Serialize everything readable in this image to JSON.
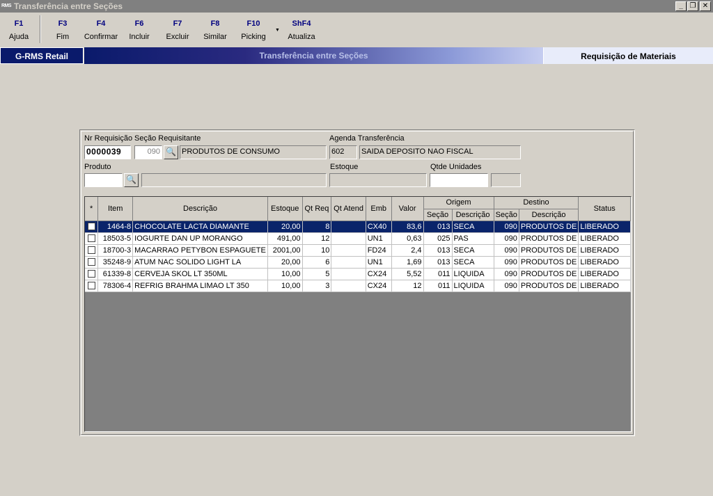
{
  "window": {
    "icon_text": "RMS",
    "title": "Transferência entre Seções",
    "controls": {
      "minimize": "_",
      "restore": "❐",
      "close": "✕"
    }
  },
  "toolbar": {
    "items": [
      {
        "key": "F1",
        "label": "Ajuda"
      },
      {
        "key": "F3",
        "label": "Fim"
      },
      {
        "key": "F4",
        "label": "Confirmar"
      },
      {
        "key": "F6",
        "label": "Incluir"
      },
      {
        "key": "F7",
        "label": "Excluir"
      },
      {
        "key": "F8",
        "label": "Similar"
      },
      {
        "key": "F10",
        "label": "Picking"
      },
      {
        "key": "ShF4",
        "label": "Atualiza"
      }
    ],
    "dropdown_arrow": "▼"
  },
  "banner": {
    "left": "G-RMS Retail",
    "middle": "Transferência entre Seções",
    "right": "Requisição de Materiais"
  },
  "form": {
    "nr_requisicao_label": "Nr Requisição",
    "nr_requisicao_value": "0000039",
    "secao_requisitante_label": "Seção Requisitante",
    "secao_code": "090",
    "secao_desc": "PRODUTOS DE CONSUMO",
    "agenda_label": "Agenda Transferência",
    "agenda_code": "602",
    "agenda_desc": "SAIDA DEPOSITO NAO FISCAL",
    "produto_label": "Produto",
    "produto_value": "",
    "produto_desc": "",
    "estoque_label": "Estoque",
    "estoque_value": "",
    "qtde_label": "Qtde Unidades",
    "qtde_value": "",
    "qtde_extra": "",
    "search_icon": "binoculars-icon"
  },
  "grid": {
    "headers": {
      "star": "*",
      "item": "Item",
      "descricao": "Descrição",
      "estoque": "Estoque",
      "qt_req": "Qt Req",
      "qt_atend": "Qt Atend",
      "emb": "Emb",
      "valor": "Valor",
      "origem": "Origem",
      "destino": "Destino",
      "secao": "Seção",
      "desc_sub": "Descrição",
      "status": "Status"
    },
    "rows": [
      {
        "item": "1464-8",
        "descricao": "CHOCOLATE LACTA DIAMANTE",
        "estoque": "20,00",
        "qt_req": "8",
        "qt_atend": "",
        "emb": "CX40",
        "valor": "83,6",
        "orig_secao": "013",
        "orig_desc": "SECA",
        "dest_secao": "090",
        "dest_desc": "PRODUTOS DE",
        "status": "LIBERADO",
        "selected": true
      },
      {
        "item": "18503-5",
        "descricao": "IOGURTE DAN UP MORANGO",
        "estoque": "491,00",
        "qt_req": "12",
        "qt_atend": "",
        "emb": "UN1",
        "valor": "0,63",
        "orig_secao": "025",
        "orig_desc": "PAS",
        "dest_secao": "090",
        "dest_desc": "PRODUTOS DE",
        "status": "LIBERADO",
        "selected": false
      },
      {
        "item": "18700-3",
        "descricao": "MACARRAO PETYBON ESPAGUETE",
        "estoque": "2001,00",
        "qt_req": "10",
        "qt_atend": "",
        "emb": "FD24",
        "valor": "2,4",
        "orig_secao": "013",
        "orig_desc": "SECA",
        "dest_secao": "090",
        "dest_desc": "PRODUTOS DE",
        "status": "LIBERADO",
        "selected": false
      },
      {
        "item": "35248-9",
        "descricao": "ATUM NAC SOLIDO LIGHT LA",
        "estoque": "20,00",
        "qt_req": "6",
        "qt_atend": "",
        "emb": "UN1",
        "valor": "1,69",
        "orig_secao": "013",
        "orig_desc": "SECA",
        "dest_secao": "090",
        "dest_desc": "PRODUTOS DE",
        "status": "LIBERADO",
        "selected": false
      },
      {
        "item": "61339-8",
        "descricao": "CERVEJA SKOL LT 350ML",
        "estoque": "10,00",
        "qt_req": "5",
        "qt_atend": "",
        "emb": "CX24",
        "valor": "5,52",
        "orig_secao": "011",
        "orig_desc": "LIQUIDA",
        "dest_secao": "090",
        "dest_desc": "PRODUTOS DE",
        "status": "LIBERADO",
        "selected": false
      },
      {
        "item": "78306-4",
        "descricao": "REFRIG BRAHMA LIMAO LT 350",
        "estoque": "10,00",
        "qt_req": "3",
        "qt_atend": "",
        "emb": "CX24",
        "valor": "12",
        "orig_secao": "011",
        "orig_desc": "LIQUIDA",
        "dest_secao": "090",
        "dest_desc": "PRODUTOS DE",
        "status": "LIBERADO",
        "selected": false
      }
    ]
  },
  "colors": {
    "window_bg": "#d4d0c8",
    "banner_dark": "#0a1a6b",
    "selection": "#0a246a",
    "toolbar_key": "#000080",
    "grid_empty": "#808080"
  }
}
